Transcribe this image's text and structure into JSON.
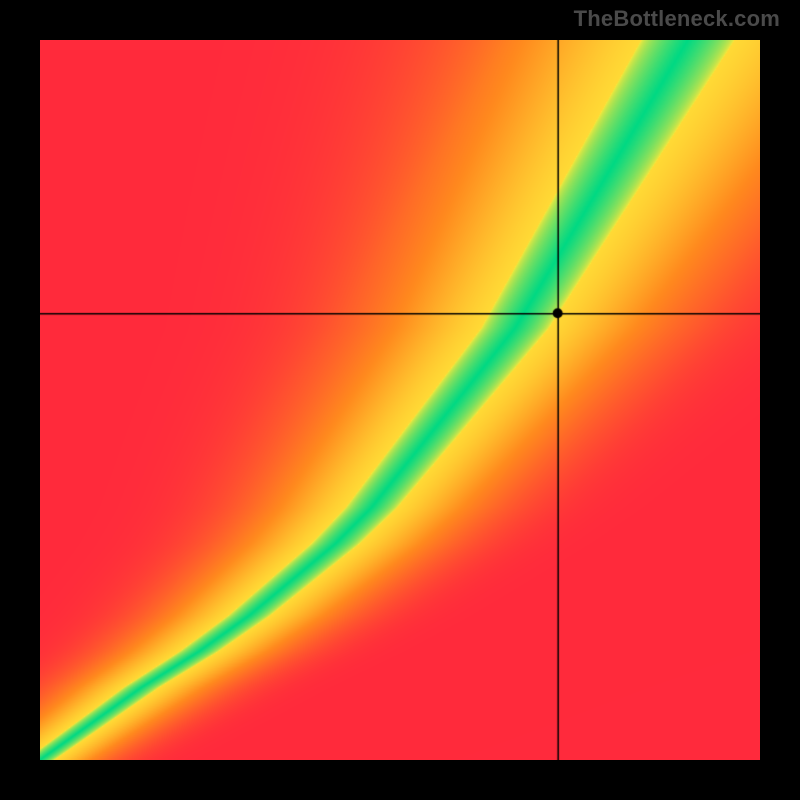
{
  "watermark": "TheBottleneck.com",
  "chart_data": {
    "type": "heatmap",
    "title": "",
    "xlabel": "",
    "ylabel": "",
    "xlim": [
      0,
      1
    ],
    "ylim": [
      0,
      1
    ],
    "crosshair": {
      "x": 0.72,
      "y": 0.62
    },
    "marker": {
      "x": 0.72,
      "y": 0.62
    },
    "ridge": {
      "description": "Green optimal band; x = f(y)",
      "points_y_to_x": [
        [
          0.0,
          0.0
        ],
        [
          0.05,
          0.07
        ],
        [
          0.1,
          0.14
        ],
        [
          0.15,
          0.22
        ],
        [
          0.2,
          0.29
        ],
        [
          0.25,
          0.35
        ],
        [
          0.3,
          0.41
        ],
        [
          0.35,
          0.46
        ],
        [
          0.4,
          0.5
        ],
        [
          0.45,
          0.54
        ],
        [
          0.5,
          0.58
        ],
        [
          0.55,
          0.62
        ],
        [
          0.6,
          0.66
        ],
        [
          0.65,
          0.69
        ],
        [
          0.7,
          0.72
        ],
        [
          0.75,
          0.75
        ],
        [
          0.8,
          0.78
        ],
        [
          0.85,
          0.81
        ],
        [
          0.9,
          0.84
        ],
        [
          0.95,
          0.87
        ],
        [
          1.0,
          0.9
        ]
      ],
      "half_width_base": 0.02,
      "half_width_top": 0.065
    },
    "secondary_band": {
      "description": "Faint lighter diagonal on the right flank",
      "offset": 0.14,
      "half_width": 0.035,
      "strength": 0.45
    },
    "colors": {
      "red": "#ff2a3c",
      "orange": "#ff8a1e",
      "yellow": "#ffe93a",
      "green": "#00d984"
    }
  }
}
